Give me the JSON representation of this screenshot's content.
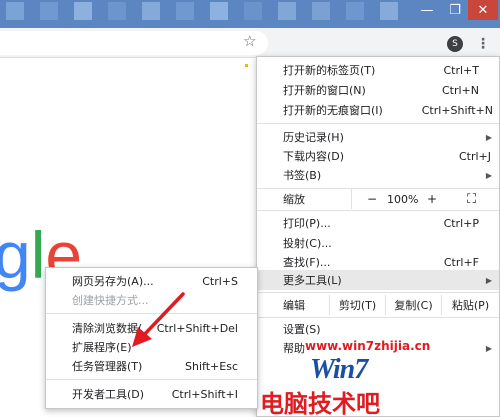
{
  "browser": {
    "avatar_letter": "S",
    "window_controls": [
      "—",
      "❐",
      "✕"
    ]
  },
  "main_menu": {
    "items_top": [
      {
        "label": "打开新的标签页(T)",
        "shortcut": "Ctrl+T"
      },
      {
        "label": "打开新的窗口(N)",
        "shortcut": "Ctrl+N"
      },
      {
        "label": "打开新的无痕窗口(I)",
        "shortcut": "Ctrl+Shift+N"
      }
    ],
    "items_history": [
      {
        "label": "历史记录(H)",
        "shortcut": "",
        "arrow": "▶"
      },
      {
        "label": "下载内容(D)",
        "shortcut": "Ctrl+J"
      },
      {
        "label": "书签(B)",
        "shortcut": "",
        "arrow": "▶"
      }
    ],
    "zoom": {
      "label": "缩放",
      "minus": "−",
      "value": "100%",
      "plus": "+",
      "fullscreen": "⛶"
    },
    "items_tools": [
      {
        "label": "打印(P)...",
        "shortcut": "Ctrl+P"
      },
      {
        "label": "投射(C)...",
        "shortcut": ""
      },
      {
        "label": "查找(F)...",
        "shortcut": "Ctrl+F"
      },
      {
        "label": "更多工具(L)",
        "shortcut": "",
        "arrow": "▶"
      }
    ],
    "edit": {
      "label": "编辑",
      "cut": "剪切(T)",
      "copy": "复制(C)",
      "paste": "粘贴(P)"
    },
    "items_bottom": [
      {
        "label": "设置(S)",
        "shortcut": ""
      },
      {
        "label": "帮助",
        "shortcut": "",
        "arrow": "▶"
      }
    ]
  },
  "sub_menu": {
    "items_a": [
      {
        "label": "网页另存为(A)...",
        "shortcut": "Ctrl+S"
      },
      {
        "label": "创建快捷方式...",
        "shortcut": ""
      }
    ],
    "items_b": [
      {
        "label": "清除浏览数据(",
        "shortcut": "Ctrl+Shift+Del"
      },
      {
        "label": "扩展程序(E)",
        "shortcut": ""
      },
      {
        "label": "任务管理器(T)",
        "shortcut": "Shift+Esc"
      }
    ],
    "items_c": [
      {
        "label": "开发者工具(D)",
        "shortcut": "Ctrl+Shift+I"
      }
    ]
  },
  "logo_letters": [
    "g",
    "l",
    "e"
  ],
  "watermark": {
    "url": "www.win7zhijia.cn",
    "logo": "Win7",
    "bottom_text": "电脑技术吧"
  },
  "colors": {
    "blue": "#4285f4",
    "green": "#34a853",
    "red": "#ea4335",
    "menu_highlight": "#e8e8e8",
    "arrow_red": "#e01c22"
  }
}
